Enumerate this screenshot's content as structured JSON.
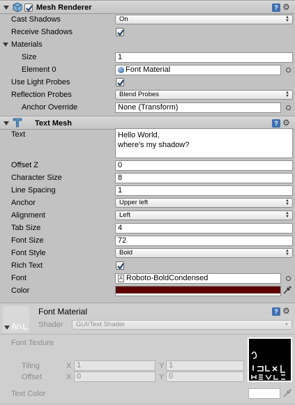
{
  "mesh_renderer": {
    "title": "Mesh Renderer",
    "enabled": true,
    "cast_shadows": {
      "label": "Cast Shadows",
      "value": "On"
    },
    "receive_shadows": {
      "label": "Receive Shadows",
      "checked": true
    },
    "materials": {
      "label": "Materials",
      "size_label": "Size",
      "size_value": "1",
      "element_label": "Element 0",
      "element_value": "Font Material"
    },
    "use_light_probes": {
      "label": "Use Light Probes",
      "checked": true
    },
    "reflection_probes": {
      "label": "Reflection Probes",
      "value": "Blend Probes"
    },
    "anchor_override": {
      "label": "Anchor Override",
      "value": "None (Transform)"
    }
  },
  "text_mesh": {
    "title": "Text Mesh",
    "text_label": "Text",
    "text_line1": "Hello World,",
    "text_line2": "where's my shadow?",
    "offset_z": {
      "label": "Offset Z",
      "value": "0"
    },
    "character_size": {
      "label": "Character Size",
      "value": "8"
    },
    "line_spacing": {
      "label": "Line Spacing",
      "value": "1"
    },
    "anchor": {
      "label": "Anchor",
      "value": "Upper left"
    },
    "alignment": {
      "label": "Alignment",
      "value": "Left"
    },
    "tab_size": {
      "label": "Tab Size",
      "value": "4"
    },
    "font_size": {
      "label": "Font Size",
      "value": "72"
    },
    "font_style": {
      "label": "Font Style",
      "value": "Bold"
    },
    "rich_text": {
      "label": "Rich Text",
      "checked": true
    },
    "font": {
      "label": "Font",
      "value": "Roboto-BoldCondensed"
    },
    "color": {
      "label": "Color",
      "swatch": "#5e0000"
    }
  },
  "material": {
    "title": "Font Material",
    "shader_label": "Shader",
    "shader_value": "GUI/Text Shader",
    "font_texture_label": "Font Texture",
    "tiling_label": "Tiling",
    "tiling_x": "1",
    "tiling_y": "1",
    "offset_label": "Offset",
    "offset_x": "0",
    "offset_y": "0",
    "x_label": "X",
    "y_label": "Y",
    "text_color_label": "Text Color",
    "text_color_swatch": "#ffffff"
  },
  "colors": {
    "panel": "#c2c2c2",
    "help_blue": "#3f6fb0"
  },
  "icons": [
    "mesh-renderer-icon",
    "text-mesh-icon",
    "help-icon",
    "gear-icon",
    "object-picker-icon",
    "eyedropper-icon",
    "foldout-arrow-icon",
    "checkmark-icon"
  ]
}
